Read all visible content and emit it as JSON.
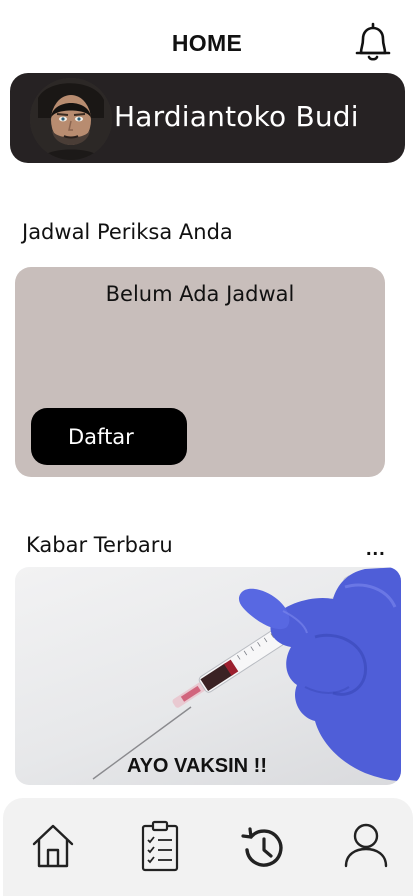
{
  "header": {
    "title": "HOME"
  },
  "profile": {
    "name": "Hardiantoko Budi"
  },
  "schedule": {
    "title": "Jadwal Periksa Anda",
    "empty_text": "Belum Ada Jadwal",
    "register_label": "Daftar"
  },
  "news": {
    "title": "Kabar Terbaru",
    "more_label": "...",
    "caption": "AYO VAKSIN !!"
  },
  "nav": {
    "items": [
      {
        "icon": "home-icon"
      },
      {
        "icon": "clipboard-checklist-icon"
      },
      {
        "icon": "history-icon"
      },
      {
        "icon": "user-icon"
      }
    ]
  },
  "colors": {
    "profile_card_bg": "#262223",
    "schedule_card_bg": "#c8bebb",
    "button_bg": "#000000",
    "nav_bg": "#f2f2f2",
    "glove": "#4f5ed8"
  }
}
